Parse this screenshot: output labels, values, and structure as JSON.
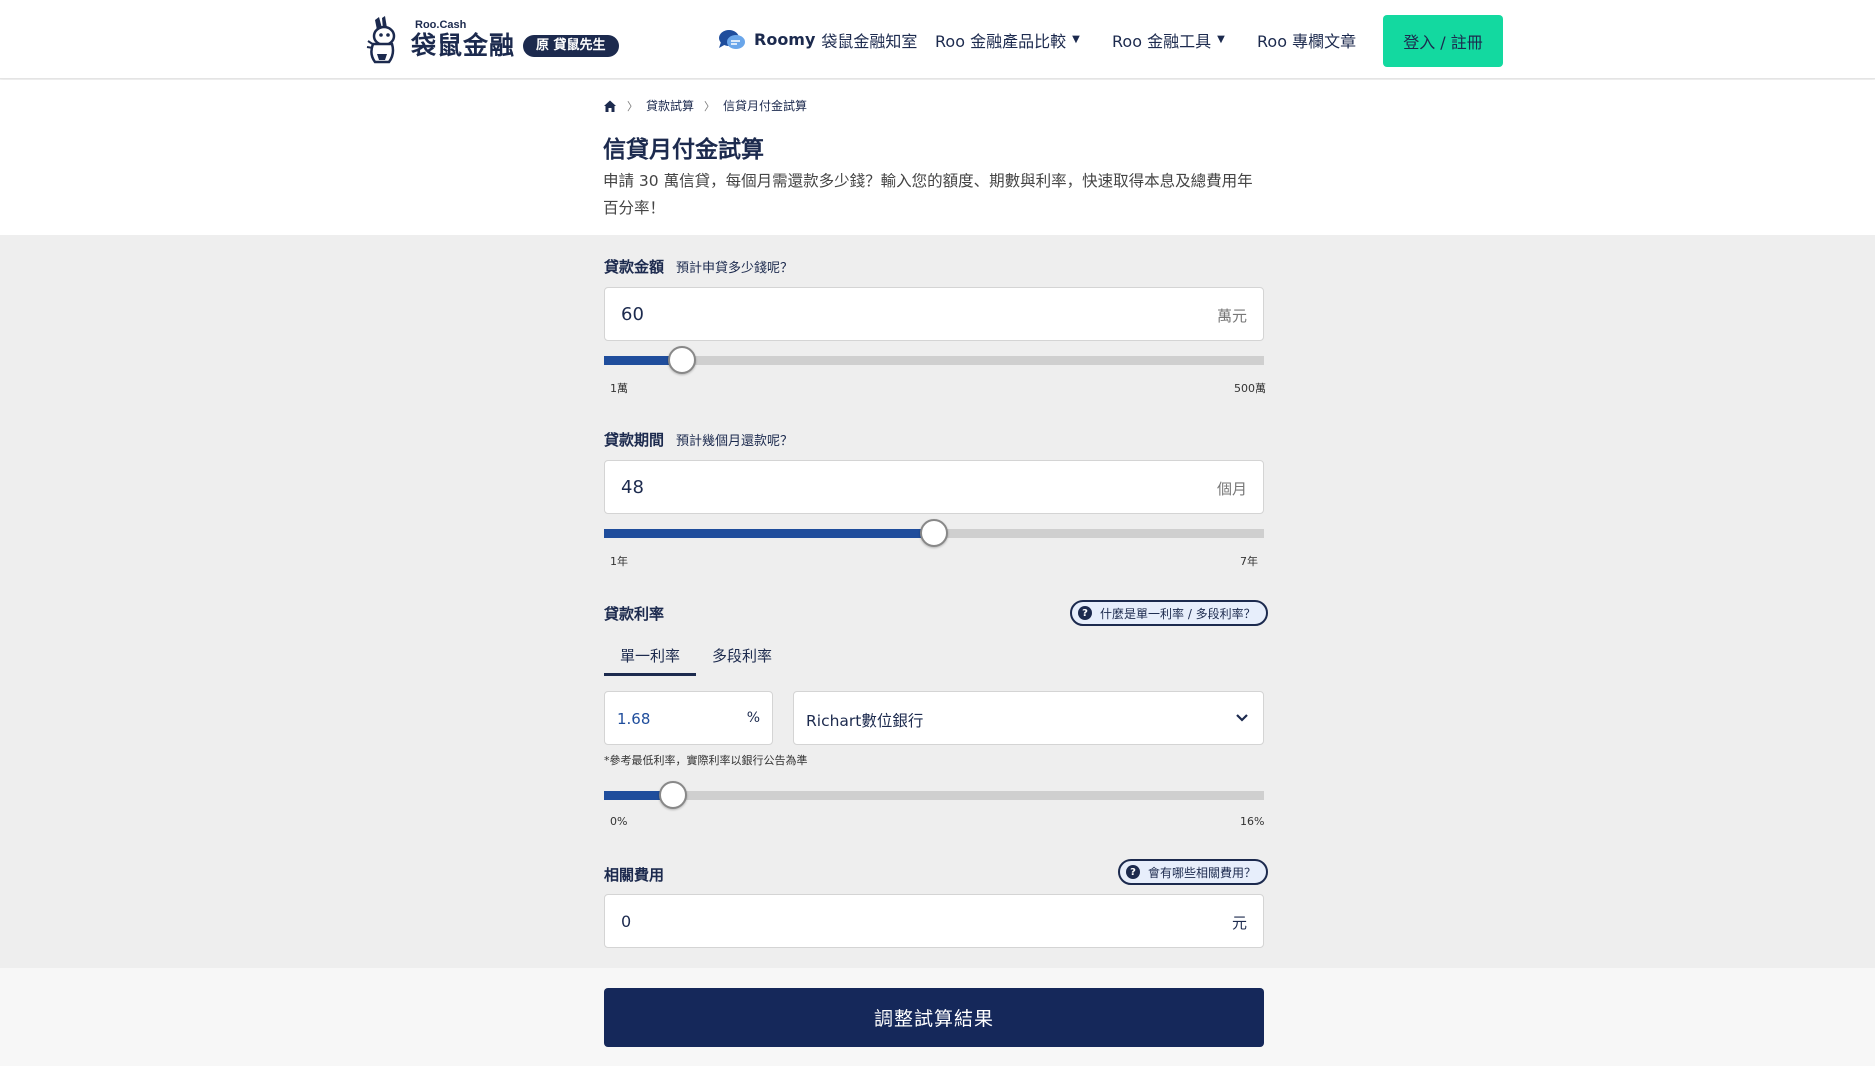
{
  "header": {
    "logo_en": "Roo.Cash",
    "logo_zh": "袋鼠金融",
    "logo_badge": "原 貸鼠先生",
    "nav": {
      "roomy_brand": "Roomy",
      "roomy_label": "袋鼠金融知室",
      "compare": "Roo 金融產品比較",
      "tools": "Roo 金融工具",
      "articles": "Roo 專欄文章"
    },
    "login": "登入 / 註冊"
  },
  "breadcrumb": [
    "貸款試算",
    "信貸月付金試算"
  ],
  "page": {
    "title": "信貸月付金試算",
    "description": "申請 30 萬信貸，每個月需還款多少錢？輸入您的額度、期數與利率，快速取得本息及總費用年百分率！"
  },
  "amount": {
    "label": "貸款金額",
    "hint": "預計申貸多少錢呢？",
    "value": "60",
    "unit": "萬元",
    "min_label": "1萬",
    "max_label": "500萬",
    "slider_fraction": 0.118
  },
  "term": {
    "label": "貸款期間",
    "hint": "預計幾個月還款呢？",
    "value": "48",
    "unit": "個月",
    "min_label": "1年",
    "max_label": "7年",
    "slider_fraction": 0.5
  },
  "rate": {
    "label": "貸款利率",
    "help": "什麼是單一利率 / 多段利率？",
    "tabs": [
      "單一利率",
      "多段利率"
    ],
    "active_tab": 0,
    "value": "1.68",
    "unit": "%",
    "bank": "Richart數位銀行",
    "note": "*參考最低利率，實際利率以銀行公告為準",
    "min_label": "0%",
    "max_label": "16%",
    "slider_fraction": 0.105
  },
  "fees": {
    "label": "相關費用",
    "help": "會有哪些相關費用？",
    "value": "0",
    "unit": "元"
  },
  "submit": "調整試算結果",
  "colors": {
    "navy": "#1c2a4e",
    "accent_green": "#13d9a0",
    "slider_fill": "#1f4d9c",
    "button": "#15285a"
  }
}
